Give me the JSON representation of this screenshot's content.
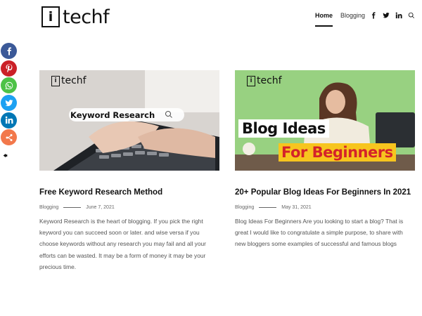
{
  "header": {
    "logo_mark": "i",
    "logo_text": "techf",
    "nav": {
      "home": "Home",
      "blogging": "Blogging",
      "icons": [
        "facebook-icon",
        "twitter-icon",
        "linkedin-icon",
        "search-icon"
      ]
    }
  },
  "share_bar": {
    "buttons": [
      {
        "name": "facebook",
        "color": "#3b5998"
      },
      {
        "name": "pinterest",
        "color": "#cb2027"
      },
      {
        "name": "whatsapp",
        "color": "#4dc247"
      },
      {
        "name": "twitter",
        "color": "#1da1f2"
      },
      {
        "name": "linkedin",
        "color": "#0077b5"
      },
      {
        "name": "share",
        "color": "#f2784b"
      }
    ]
  },
  "posts": [
    {
      "thumb": {
        "logo_mark": "i",
        "logo_text": "techf",
        "overlay": "Keyword Research"
      },
      "title": "Free Keyword Research Method",
      "category": "Blogging",
      "date": "June 7, 2021",
      "excerpt": "Keyword Research is the heart of blogging. If you pick the right keyword you can succeed soon or later. and wise versa if you choose keywords without any research you may fail and all your efforts can be wasted. It may be a form of money it may be your precious time."
    },
    {
      "thumb": {
        "logo_mark": "i",
        "logo_text": "techf",
        "overlay_line1": "Blog Ideas",
        "overlay_line2": "For Beginners"
      },
      "title": "20+ Popular Blog Ideas For Beginners In 2021",
      "category": "Blogging",
      "date": "May 31, 2021",
      "excerpt": "Blog Ideas For Beginners Are you looking to start a blog? That is great I would like to congratulate a simple purpose, to share with new bloggers some examples of successful and famous blogs"
    }
  ]
}
